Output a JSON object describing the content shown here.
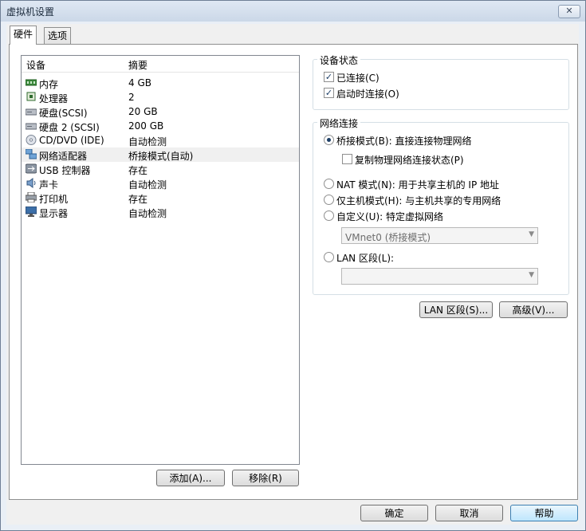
{
  "window": {
    "title": "虚拟机设置",
    "close": "✕"
  },
  "tabs": [
    {
      "label": "硬件"
    },
    {
      "label": "选项"
    }
  ],
  "device_list": {
    "col_device": "设备",
    "col_summary": "摘要",
    "rows": [
      {
        "name": "内存",
        "summary": "4 GB",
        "icon": "memory-icon"
      },
      {
        "name": "处理器",
        "summary": "2",
        "icon": "processor-icon"
      },
      {
        "name": "硬盘(SCSI)",
        "summary": "20 GB",
        "icon": "hard-disk-icon"
      },
      {
        "name": "硬盘 2 (SCSI)",
        "summary": "200 GB",
        "icon": "hard-disk-icon"
      },
      {
        "name": "CD/DVD (IDE)",
        "summary": "自动检测",
        "icon": "cd-dvd-icon"
      },
      {
        "name": "网络适配器",
        "summary": "桥接模式(自动)",
        "icon": "network-adapter-icon"
      },
      {
        "name": "USB 控制器",
        "summary": "存在",
        "icon": "usb-icon"
      },
      {
        "name": "声卡",
        "summary": "自动检测",
        "icon": "sound-card-icon"
      },
      {
        "name": "打印机",
        "summary": "存在",
        "icon": "printer-icon"
      },
      {
        "name": "显示器",
        "summary": "自动检测",
        "icon": "display-icon"
      }
    ],
    "add_label": "添加(A)...",
    "remove_label": "移除(R)"
  },
  "device_status": {
    "title": "设备状态",
    "connected": {
      "label": "已连接(C)",
      "checked": true
    },
    "connect_at_power_on": {
      "label": "启动时连接(O)",
      "checked": true
    }
  },
  "network": {
    "title": "网络连接",
    "bridged": {
      "label": "桥接模式(B): 直接连接物理网络",
      "selected": true
    },
    "replicate": {
      "label": "复制物理网络连接状态(P)",
      "checked": false
    },
    "nat": {
      "label": "NAT 模式(N): 用于共享主机的 IP 地址",
      "selected": false
    },
    "host_only": {
      "label": "仅主机模式(H): 与主机共享的专用网络",
      "selected": false
    },
    "custom": {
      "label": "自定义(U): 特定虚拟网络",
      "selected": false
    },
    "custom_select_value": "VMnet0 (桥接模式)",
    "lan_segment": {
      "label": "LAN 区段(L):",
      "selected": false
    },
    "lan_select_value": "",
    "lan_segments_button": "LAN 区段(S)...",
    "advanced_button": "高级(V)..."
  },
  "footer": {
    "ok": "确定",
    "cancel": "取消",
    "help": "帮助"
  }
}
